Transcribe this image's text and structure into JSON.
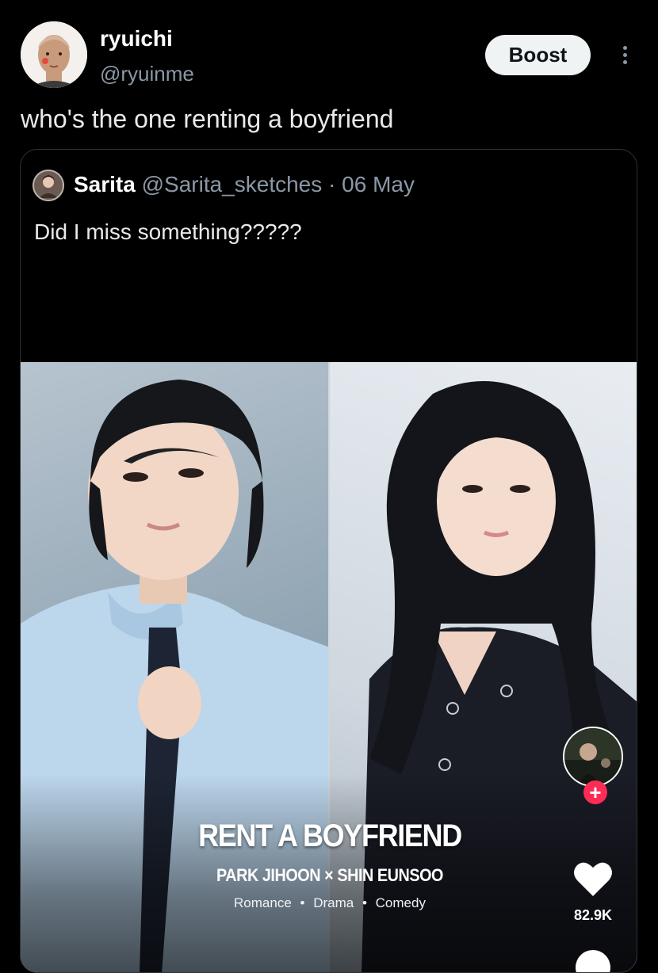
{
  "post": {
    "author_name": "ryuichi",
    "author_handle": "@ryuinme",
    "boost_label": "Boost",
    "text": "who's the one renting a boyfriend"
  },
  "quote": {
    "author_name": "Sarita",
    "author_handle": "@Sarita_sketches",
    "separator": "·",
    "date": "06 May",
    "text": "Did I miss something?????"
  },
  "media": {
    "title": "RENT A BOYFRIEND",
    "cast_left": "PARK JIHOON",
    "cast_joiner": "×",
    "cast_right": "SHIN EUNSOO",
    "genres": [
      "Romance",
      "Drama",
      "Comedy"
    ],
    "genre_bullet": "•",
    "follow_symbol": "+",
    "like_count": "82.9K"
  },
  "colors": {
    "background": "#000000",
    "text_primary": "#e7e9ea",
    "text_secondary": "#8b98a5",
    "border": "#2f3336",
    "boost_bg": "#eff3f4",
    "follow_accent": "#fe2c55"
  },
  "icons": {
    "more": "more-vertical-icon",
    "like": "heart-icon",
    "follow": "plus-icon",
    "comment": "comment-icon"
  }
}
